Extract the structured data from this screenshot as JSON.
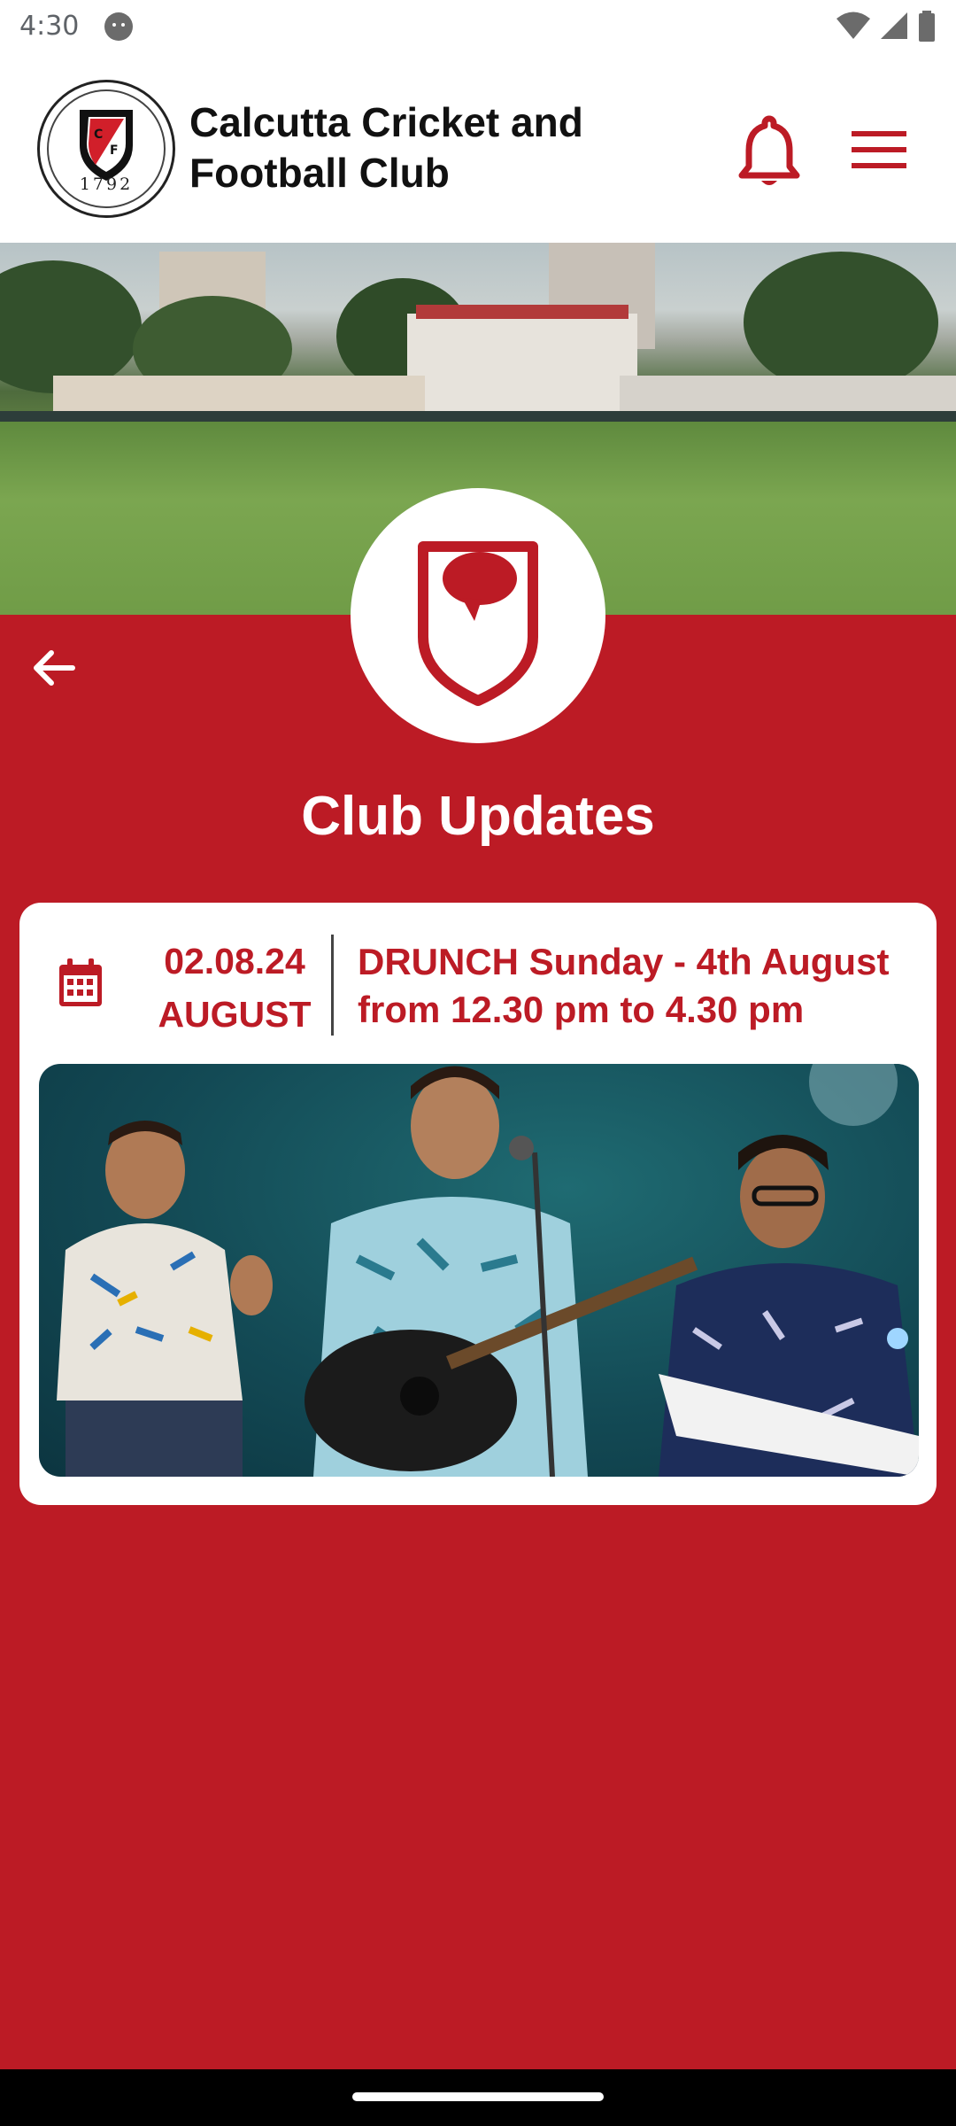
{
  "status_bar": {
    "time": "4:30"
  },
  "header": {
    "club_name": "Calcutta Cricket and Football Club",
    "logo_year": "1792",
    "logo_letters": "CF",
    "brand_color": "#bc1b25"
  },
  "page": {
    "title": "Club Updates"
  },
  "updates": [
    {
      "date": "02.08.24",
      "month": "AUGUST",
      "title": "DRUNCH Sunday - 4th August from 12.30 pm to 4.30 pm"
    }
  ]
}
